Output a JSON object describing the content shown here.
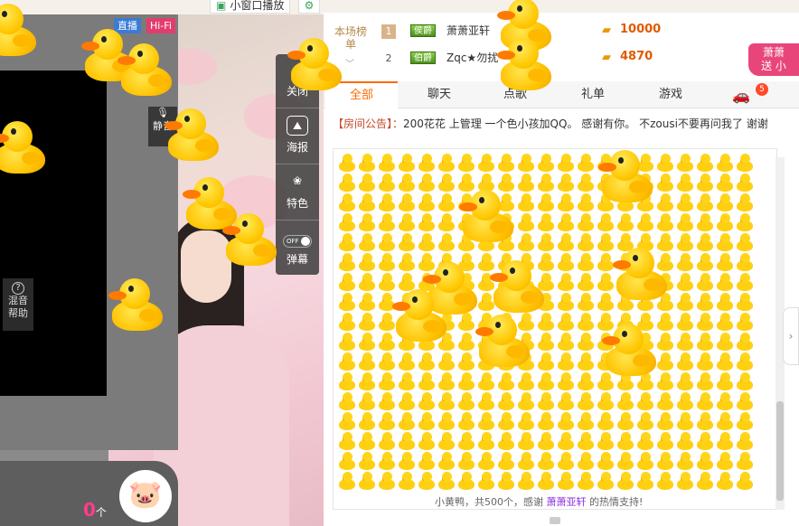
{
  "video": {
    "badge_live": "直播",
    "badge_hifi": "Hi-Fi",
    "mic_label": "静音",
    "mix_help_line1": "混音",
    "mix_help_line2": "帮助",
    "gift_count": "0",
    "gift_count_unit": "个"
  },
  "topbar": {
    "miniwin_label": "小窗口播放"
  },
  "tools": [
    {
      "label": "关闭"
    },
    {
      "label": "海报"
    },
    {
      "label": "特色"
    },
    {
      "label": "弹幕",
      "toggle_text": "OFF"
    }
  ],
  "rank": {
    "title": "本场榜单",
    "rows": [
      {
        "rank": "1",
        "level": "侯爵",
        "name": "萧萧亚轩",
        "value": "10000"
      },
      {
        "rank": "2",
        "level": "伯爵",
        "name": "Zqc★勿扰",
        "value": "4870"
      }
    ]
  },
  "promo": {
    "line1": "萧萧",
    "line2": "送 小"
  },
  "tabs": [
    {
      "label": "全部",
      "active": true
    },
    {
      "label": "聊天"
    },
    {
      "label": "点歌"
    },
    {
      "label": "礼单"
    },
    {
      "label": "游戏"
    }
  ],
  "car_badge": "5",
  "notice": {
    "label": "【房间公告】：",
    "text": "200花花 上管理 一个色小孩加QQ。 感谢有你。 不zousi不要再问我了 谢谢"
  },
  "gift_message": {
    "prefix": "小黄鸭，共500个，感谢 ",
    "nick": "萧萧亚轩",
    "suffix": " 的热情支持!"
  },
  "colors": {
    "accent": "#ff6a00",
    "duck_yellow": "#ffc300",
    "live_blue": "#3a7bd5",
    "hifi_pink": "#e23d6c"
  }
}
